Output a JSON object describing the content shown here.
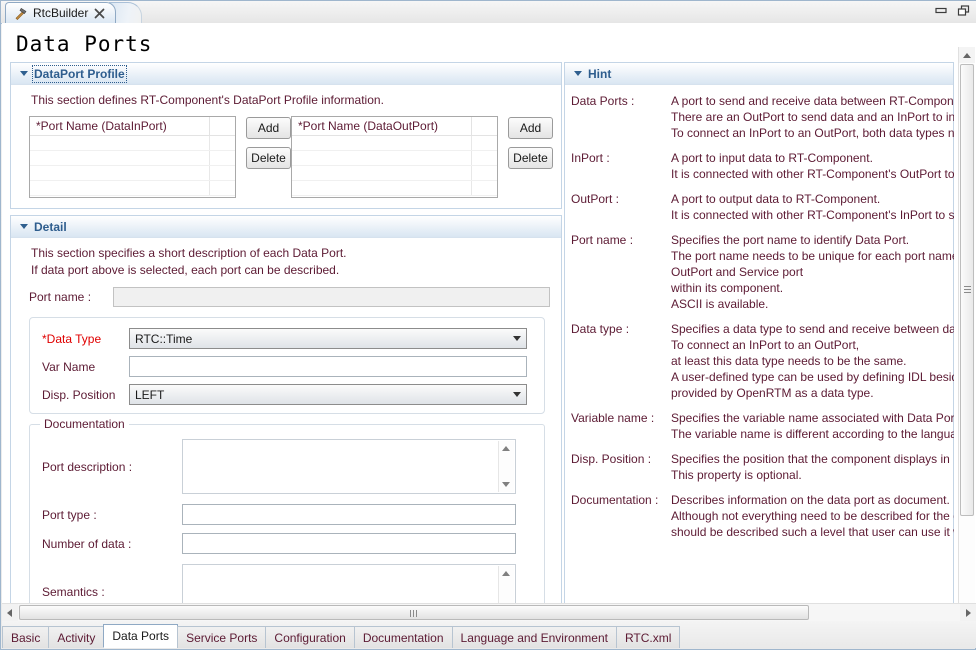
{
  "window": {
    "tab_label": "RtcBuilder",
    "tab_icon": "hammer-icon",
    "close_icon": "close-icon",
    "minimize_label": "Minimize",
    "maximize_label": "Restore"
  },
  "page": {
    "title": "Data Ports"
  },
  "dataport_profile": {
    "title": "DataPort Profile",
    "description": "This section defines RT-Component's DataPort Profile information.",
    "inport_table": {
      "header": "*Port Name (DataInPort)",
      "rows": [
        "",
        "",
        "",
        ""
      ],
      "add_label": "Add",
      "delete_label": "Delete"
    },
    "outport_table": {
      "header": "*Port Name (DataOutPort)",
      "rows": [
        "",
        "",
        "",
        ""
      ],
      "add_label": "Add",
      "delete_label": "Delete"
    }
  },
  "detail": {
    "title": "Detail",
    "description_line1": "This section specifies a short description of each Data Port.",
    "description_line2": "If data port above is selected, each port can be described.",
    "port_name_label": "Port name :",
    "port_name_value": "",
    "data_type_label": "*Data Type",
    "data_type_value": "RTC::Time",
    "var_name_label": "Var Name",
    "var_name_value": "",
    "disp_position_label": "Disp. Position",
    "disp_position_value": "LEFT",
    "documentation": {
      "legend": "Documentation",
      "port_description_label": "Port description :",
      "port_description_value": "",
      "port_type_label": "Port type :",
      "port_type_value": "",
      "number_of_data_label": "Number of data :",
      "number_of_data_value": "",
      "semantics_label": "Semantics :",
      "semantics_value": ""
    }
  },
  "hint": {
    "title": "Hint",
    "items": [
      {
        "key": "Data Ports :",
        "lines": [
          "A port to send and receive data between RT-Component.",
          "There are an OutPort to send data and an InPort to input data.",
          "To connect an InPort to an OutPort, both data types need to be the same."
        ]
      },
      {
        "key": "InPort :",
        "lines": [
          "A port to input data to RT-Component.",
          "It is connected with other RT-Component's OutPort to receive data."
        ]
      },
      {
        "key": "OutPort :",
        "lines": [
          "A port to output data to RT-Component.",
          "It is connected with other RT-Component's InPort to send data."
        ]
      },
      {
        "key": "Port name :",
        "lines": [
          "Specifies the port name to identify Data Port.",
          "The port name needs to be unique for each port name of InPort,",
          "OutPort and Service port",
          "within its component.",
          "ASCII is available."
        ]
      },
      {
        "key": "Data type :",
        "lines": [
          "Specifies a data type to send and receive between data ports.",
          "To connect an InPort to an OutPort,",
          "at least this data type needs to be the same.",
          "A user-defined type can be used by defining IDL beside the type",
          "provided by OpenRTM as a data type."
        ]
      },
      {
        "key": "Variable name :",
        "lines": [
          "Specifies the variable name associated with Data Ports.",
          "The variable name is different according to the language."
        ]
      },
      {
        "key": "Disp. Position :",
        "lines": [
          "Specifies the position that the component displays in RTSystemEditor.",
          "This property is optional."
        ]
      },
      {
        "key": "Documentation :",
        "lines": [
          "Describes information on the data port as document.",
          "Although not everything need to be described for the data port, it",
          "should be described such a level that user can use it without manual."
        ]
      }
    ]
  },
  "bottom_tabs": {
    "active": "Data Ports",
    "items": [
      "Basic",
      "Activity",
      "Data Ports",
      "Service Ports",
      "Configuration",
      "Documentation",
      "Language and Environment",
      "RTC.xml"
    ]
  },
  "scrollbars": {
    "vertical_icon": "scrollbar-vertical",
    "horizontal_icon": "scrollbar-horizontal"
  },
  "colors": {
    "label": "#5c1a33",
    "required": "#e00000",
    "section_title": "#2e5d8e",
    "section_border": "#c4d5e6"
  }
}
